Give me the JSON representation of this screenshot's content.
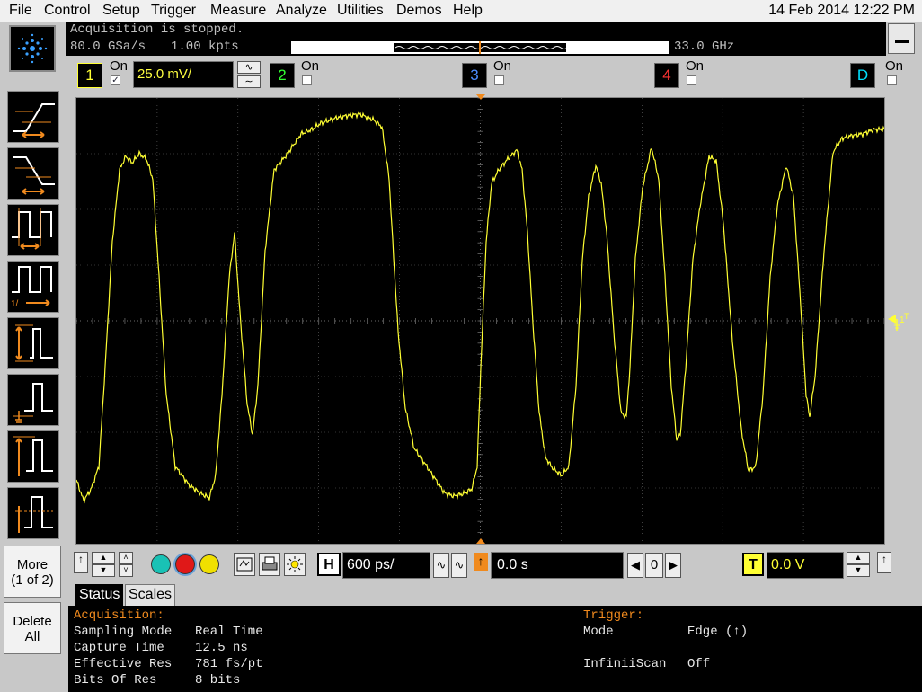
{
  "menu": [
    "File",
    "Control",
    "Setup",
    "Trigger",
    "Measure",
    "Analyze",
    "Utilities",
    "Demos",
    "Help"
  ],
  "datetime": "14 Feb 2014 12:22 PM",
  "acquisition_header": {
    "state": "Acquisition is stopped.",
    "sample_rate": "80.0 GSa/s",
    "points": "1.00 kpts",
    "bandwidth": "33.0 GHz"
  },
  "channels": [
    {
      "number": "1",
      "on_label": "On",
      "checked": true,
      "scale": "25.0 mV/",
      "color": "#ffff33"
    },
    {
      "number": "2",
      "on_label": "On",
      "checked": false,
      "color": "#33ff33"
    },
    {
      "number": "3",
      "on_label": "On",
      "checked": false,
      "color": "#4d8cff"
    },
    {
      "number": "4",
      "on_label": "On",
      "checked": false,
      "color": "#ff3333"
    },
    {
      "number": "D",
      "on_label": "On",
      "checked": false,
      "color": "#00e0ff"
    }
  ],
  "side_buttons": {
    "more": "More",
    "more_page": "(1 of 2)",
    "delete": "Delete",
    "delete2": "All"
  },
  "measure_tools": [
    "rise-time-icon",
    "fall-time-icon",
    "period-icon",
    "frequency-icon",
    "v-peak-to-peak-icon",
    "v-min-icon",
    "v-max-icon",
    "v-average-icon"
  ],
  "timebase": {
    "h_label": "H",
    "scale": "600 ps/",
    "position": "0.0 s",
    "zoom": "0"
  },
  "trigger_ctl": {
    "t_label": "T",
    "level": "0.0 V"
  },
  "tabs": [
    "Status",
    "Scales"
  ],
  "status": {
    "acq_title": "Acquisition:",
    "rows": [
      {
        "label": "Sampling Mode",
        "value": "Real Time"
      },
      {
        "label": "Capture Time",
        "value": "12.5 ns"
      },
      {
        "label": "Effective Res",
        "value": "781 fs/pt"
      },
      {
        "label": "Bits Of Res",
        "value": "8 bits"
      }
    ],
    "trig_title": "Trigger:",
    "trig_rows": [
      {
        "label": "Mode",
        "value": "Edge (↑)"
      },
      {
        "label": "InfiniiScan",
        "value": "Off"
      }
    ]
  },
  "colors": {
    "trace": "#ffff33",
    "accent": "#f08a1e",
    "grid": "#6a6a6a"
  }
}
